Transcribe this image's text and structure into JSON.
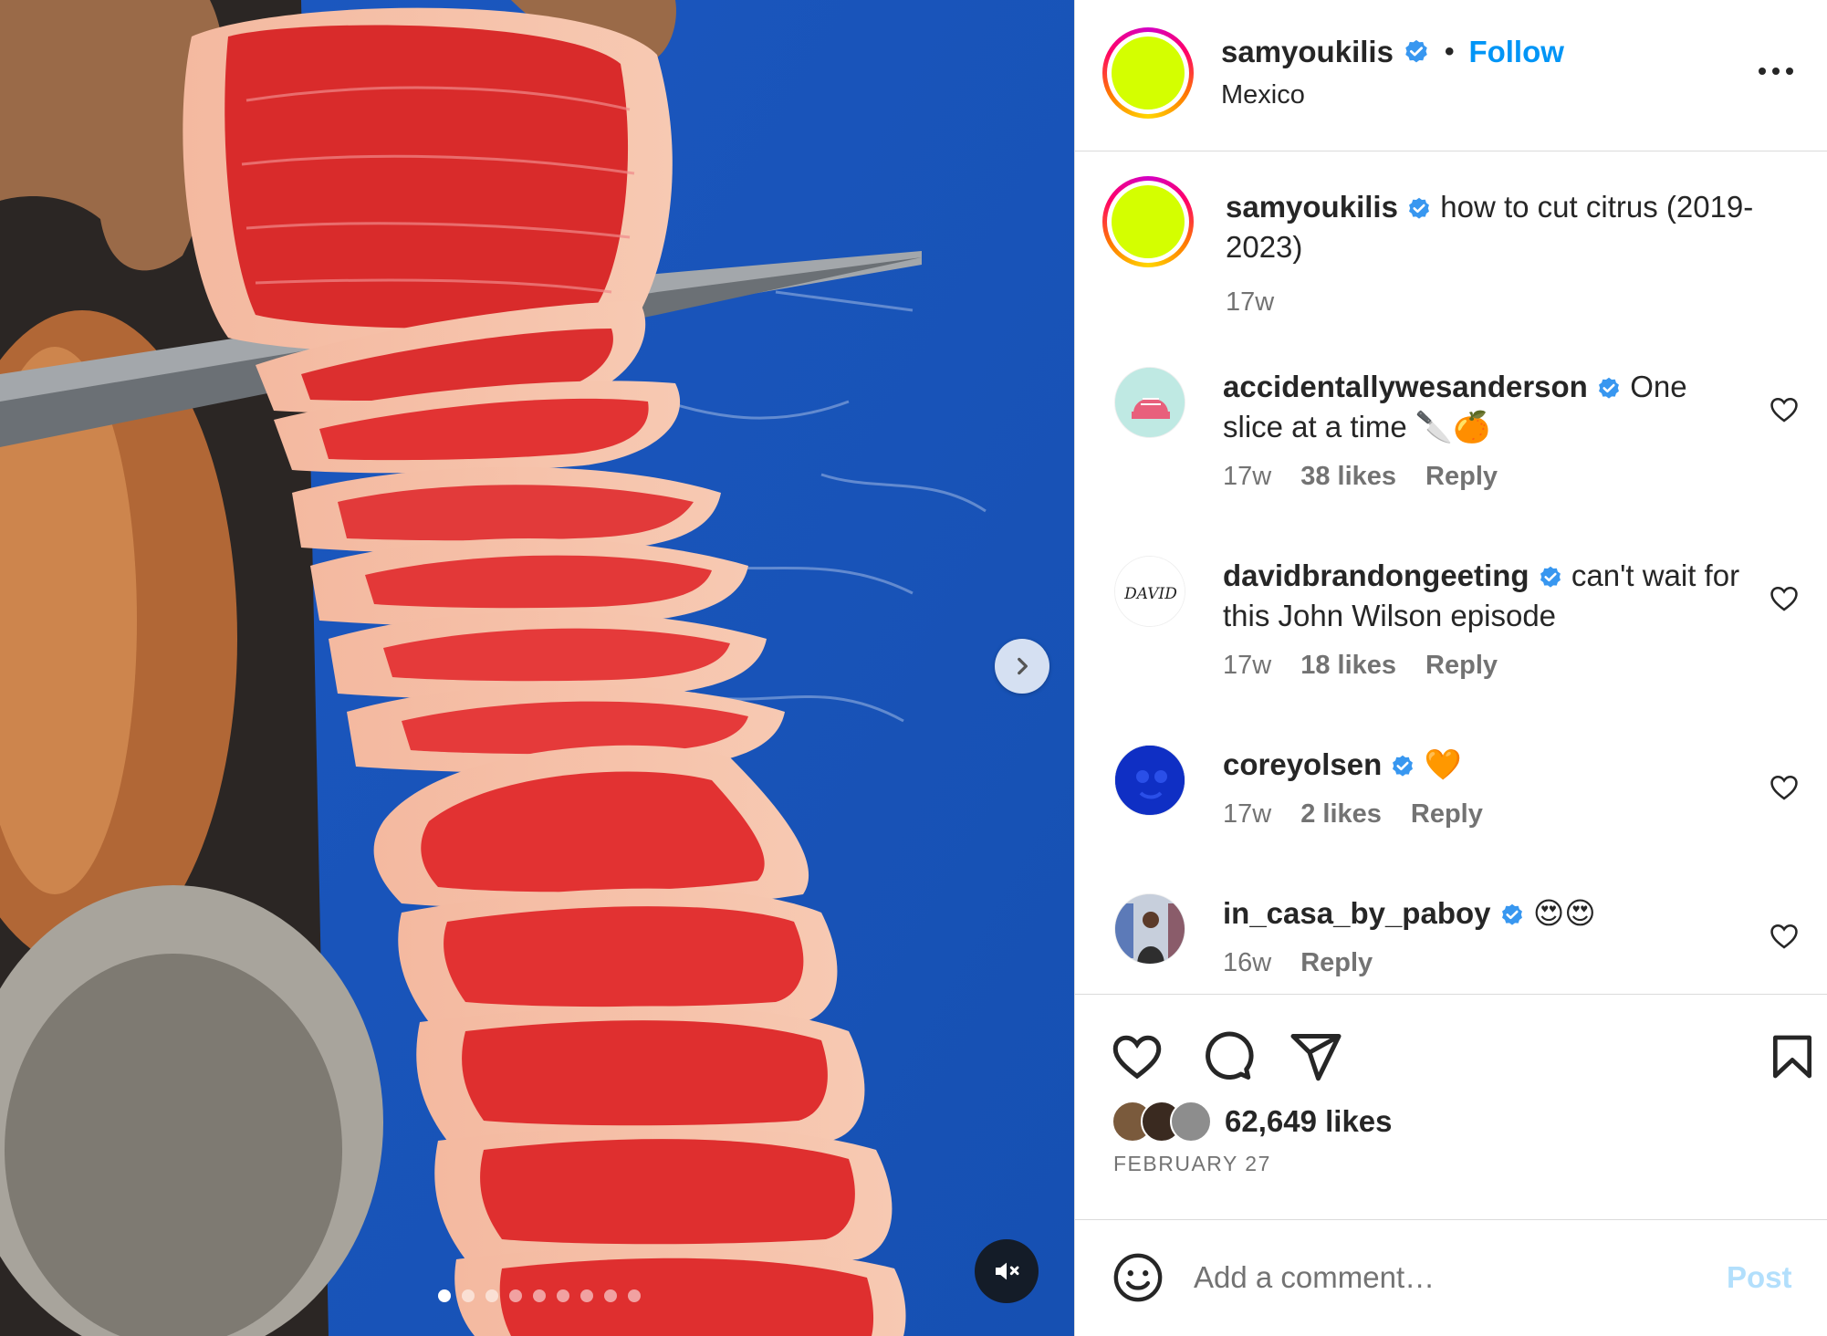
{
  "post": {
    "author": "samyoukilis",
    "follow_label": "Follow",
    "separator": "•",
    "location": "Mexico",
    "caption_author": "samyoukilis",
    "caption_text": "how to cut citrus (2019-2023)",
    "caption_age": "17w",
    "avatar_color": "#d4ff00",
    "media": {
      "carousel_dots": 9,
      "active_dot": 0,
      "muted": true
    }
  },
  "comments": [
    {
      "user": "accidentallywesanderson",
      "text": "One slice at a time 🔪🍊",
      "age": "17w",
      "likes": "38 likes",
      "reply": "Reply",
      "avatar": "pink-cake-avatar"
    },
    {
      "user": "davidbrandongeeting",
      "text": "can't wait for this John Wilson episode",
      "age": "17w",
      "likes": "18 likes",
      "reply": "Reply",
      "avatar": "david-logo-avatar"
    },
    {
      "user": "coreyolsen",
      "text": "🧡",
      "age": "17w",
      "likes": "2 likes",
      "reply": "Reply",
      "avatar": "blue-face-avatar"
    },
    {
      "user": "in_casa_by_paboy",
      "text": "😍😍",
      "age": "16w",
      "likes": "",
      "reply": "Reply",
      "avatar": "person-photo-avatar"
    }
  ],
  "actions": {
    "likes_count": "62,649 likes",
    "date": "FEBRUARY 27",
    "icons": [
      "heart-icon",
      "comment-icon",
      "share-icon",
      "bookmark-icon"
    ]
  },
  "add_comment": {
    "placeholder": "Add a comment…",
    "post_label": "Post"
  },
  "colors": {
    "accent": "#0095f6",
    "verified": "#3897f0",
    "muted_text": "#737373",
    "post_disabled": "#b2dffc"
  }
}
